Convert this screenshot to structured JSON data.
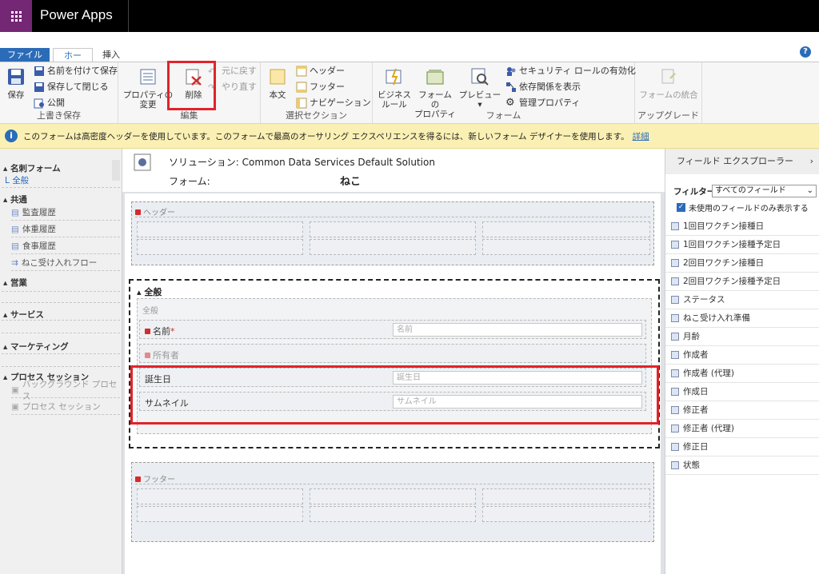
{
  "app": {
    "title": "Power Apps"
  },
  "tabs": {
    "file": "ファイル",
    "home": "ホーム",
    "insert": "挿入"
  },
  "ribbon": {
    "save": "保存",
    "save_as": "名前を付けて保存",
    "save_close": "保存して閉じる",
    "publish": "公開",
    "group_save": "上書き保存",
    "props_change_l1": "プロパティの",
    "props_change_l2": "変更",
    "delete": "削除",
    "undo": "元に戻す",
    "redo": "やり直す",
    "group_edit": "編集",
    "body": "本文",
    "header": "ヘッダー",
    "footer": "フッター",
    "navigation": "ナビゲーション",
    "group_select": "選択セクション",
    "biz_rule_l1": "ビジネス",
    "biz_rule_l2": "ルール",
    "form_props_l1": "フォームの",
    "form_props_l2": "プロパティ",
    "preview": "プレビュー",
    "security_roles": "セキュリティ ロールの有効化",
    "dependencies": "依存関係を表示",
    "managed_props": "管理プロパティ",
    "group_form": "フォーム",
    "merge_forms": "フォームの統合",
    "group_upgrade": "アップグレード"
  },
  "infobar": {
    "message": "このフォームは高密度ヘッダーを使用しています。このフォームで最高のオーサリング エクスペリエンスを得るには、新しいフォーム デザイナーを使用します。",
    "link": "詳細"
  },
  "leftnav": {
    "form_title": "名刺フォーム",
    "general": "L 全般",
    "common": "共通",
    "common_items": [
      "監査履歴",
      "体重履歴",
      "食事履歴",
      "ねこ受け入れフロー"
    ],
    "sales": "営業",
    "service": "サービス",
    "marketing": "マーケティング",
    "process": "プロセス セッション",
    "process_items": [
      "バックグラウンド プロセス",
      "プロセス セッション"
    ]
  },
  "canvas": {
    "solution_label": "ソリューション:",
    "solution_name": "Common Data Services Default Solution",
    "form_label": "フォーム:",
    "form_name": "ねこ",
    "header_label": "ヘッダー",
    "tab_label": "全般",
    "section_label": "全般",
    "name_label": "名前",
    "name_required": "*",
    "name_placeholder": "名前",
    "owner_label": "所有者",
    "birthday_label": "誕生日",
    "birthday_placeholder": "誕生日",
    "thumbnail_label": "サムネイル",
    "thumbnail_placeholder": "サムネイル",
    "footer_label": "フッター"
  },
  "rightpanel": {
    "title": "フィールド エクスプローラー",
    "filter_label": "フィルター",
    "filter_value": "すべてのフィールド",
    "checkbox_label": "未使用のフィールドのみ表示する",
    "fields": [
      "1回目ワクチン接種日",
      "1回目ワクチン接種予定日",
      "2回目ワクチン接種日",
      "2回目ワクチン接種予定日",
      "ステータス",
      "ねこ受け入れ準備",
      "月齢",
      "作成者",
      "作成者 (代理)",
      "作成日",
      "修正者",
      "修正者 (代理)",
      "修正日",
      "状態"
    ]
  },
  "colors": {
    "accent": "#2b6cb8",
    "brand": "#742774",
    "highlight": "#e0242b",
    "infobar": "#fbf0b4"
  }
}
